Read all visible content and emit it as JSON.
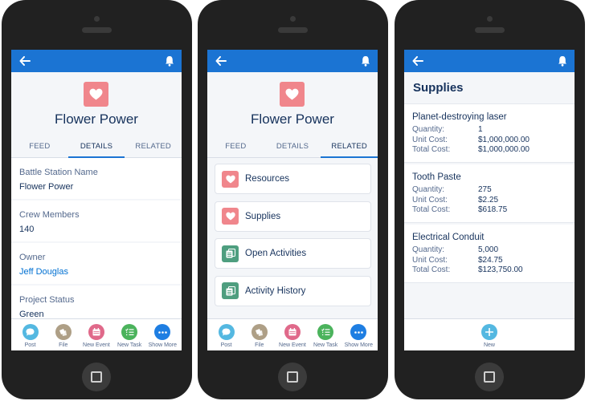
{
  "colors": {
    "frame": "#212121",
    "header": "#1b74d3",
    "record_icon": "#f0868c",
    "activity_icon": "#4e9e7f",
    "text": "#16325c",
    "link": "#0070d2",
    "label": "#54698d",
    "new_button": "#54b8e1"
  },
  "common": {
    "back_icon": "arrow-left-icon",
    "bell_icon": "bell-icon",
    "record_title": "Flower Power",
    "record_icon": "heart-icon",
    "tabs": [
      {
        "label": "FEED"
      },
      {
        "label": "DETAILS"
      },
      {
        "label": "RELATED"
      }
    ],
    "actions": [
      {
        "label": "Post",
        "icon": "chat-bubble-icon",
        "color": "#54b8e1"
      },
      {
        "label": "File",
        "icon": "file-icon",
        "color": "#ae9f86"
      },
      {
        "label": "New Event",
        "icon": "calendar-icon",
        "color": "#e0698a"
      },
      {
        "label": "New Task",
        "icon": "task-checklist-icon",
        "color": "#4bb35c"
      },
      {
        "label": "Show More",
        "icon": "more-dots-icon",
        "color": "#1e7ee2"
      }
    ]
  },
  "details_screen": {
    "active_tab": 1,
    "fields": [
      {
        "label": "Battle Station Name",
        "value": "Flower Power",
        "is_link": false
      },
      {
        "label": "Crew Members",
        "value": "140",
        "is_link": false
      },
      {
        "label": "Owner",
        "value": "Jeff Douglas",
        "is_link": true
      },
      {
        "label": "Project Status",
        "value": "Green",
        "is_link": false
      }
    ]
  },
  "related_screen": {
    "active_tab": 2,
    "lists": [
      {
        "label": "Resources",
        "icon": "heart-icon"
      },
      {
        "label": "Supplies",
        "icon": "heart-icon"
      },
      {
        "label": "Open Activities",
        "icon": "activities-icon"
      },
      {
        "label": "Activity History",
        "icon": "activities-icon"
      }
    ]
  },
  "supplies_screen": {
    "title": "Supplies",
    "row_labels": {
      "quantity": "Quantity:",
      "unit_cost": "Unit Cost:",
      "total_cost": "Total Cost:"
    },
    "items": [
      {
        "name": "Planet-destroying laser",
        "quantity": "1",
        "unit_cost": "$1,000,000.00",
        "total_cost": "$1,000,000.00"
      },
      {
        "name": "Tooth Paste",
        "quantity": "275",
        "unit_cost": "$2.25",
        "total_cost": "$618.75"
      },
      {
        "name": "Electrical Conduit",
        "quantity": "5,000",
        "unit_cost": "$24.75",
        "total_cost": "$123,750.00"
      }
    ],
    "new_action": {
      "label": "New",
      "icon": "plus-icon"
    }
  }
}
